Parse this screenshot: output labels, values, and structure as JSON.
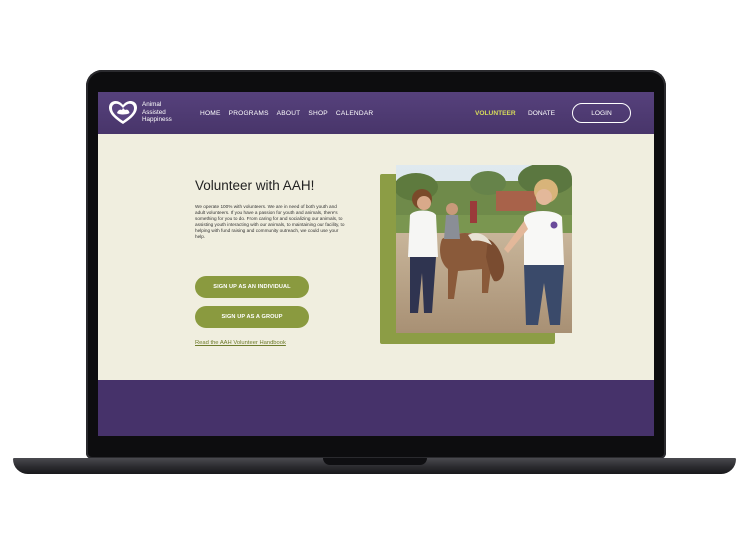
{
  "header": {
    "logo_lines": [
      "Animal",
      "Assisted",
      "Happiness"
    ],
    "nav": [
      "HOME",
      "PROGRAMS",
      "ABOUT",
      "SHOP",
      "CALENDAR"
    ],
    "volunteer_label": "VOLUNTEER",
    "donate_label": "DONATE",
    "login_label": "LOGIN"
  },
  "main": {
    "title": "Volunteer with AAH!",
    "intro": "We operate 100% with volunteers. We are in need of both youth and adult volunteers. If you have a passion for youth and animals, there's something for you to do. From caring for and socializing our animals, to assisting youth interacting with our animals, to maintaining our facility, to helping with fund raising and community outreach, we could use your help.",
    "individual_button": "SIGN UP AS AN INDIVIDUAL",
    "group_button": "SIGN UP AS A GROUP",
    "handbook_link": "Read the AAH Volunteer Handbook"
  },
  "colors": {
    "header_purple": "#4e3a72",
    "accent_green": "#8a9a3f",
    "volunteer_highlight": "#d7db5a",
    "page_background": "#f0eedf"
  }
}
